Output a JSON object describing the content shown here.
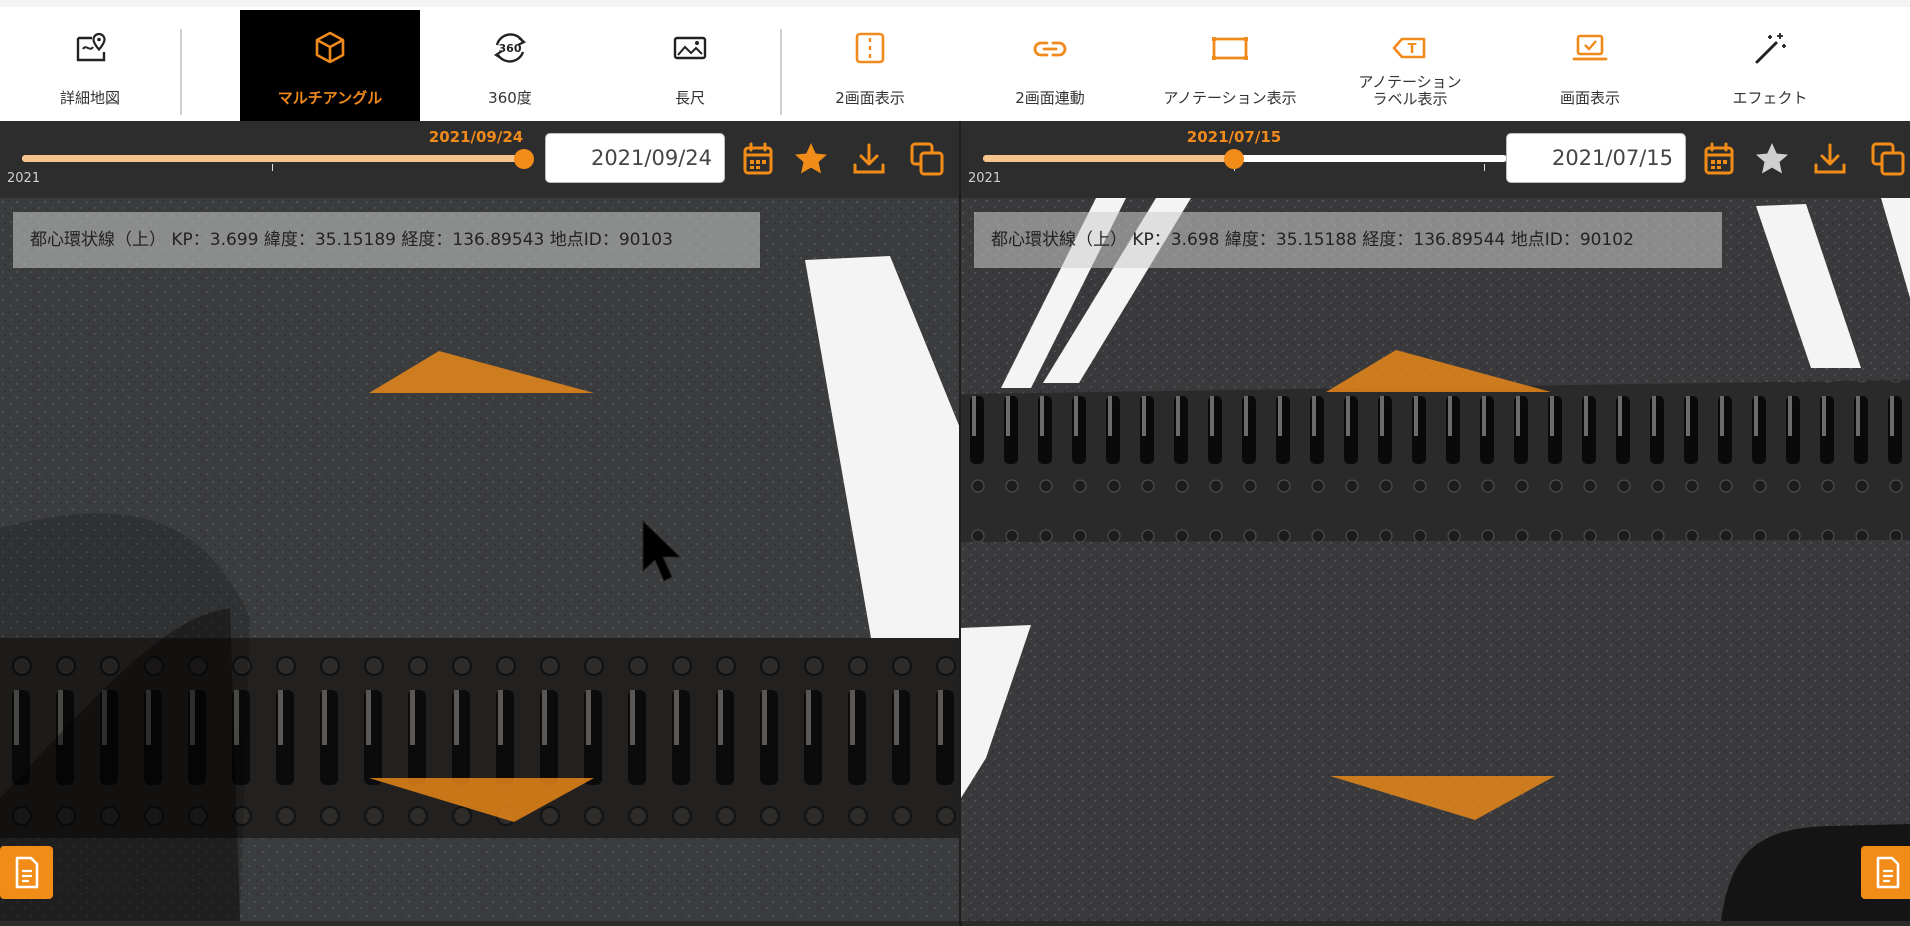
{
  "toolbar": {
    "items": [
      {
        "label": "詳細地図",
        "icon": "map-pin-icon"
      },
      {
        "label": "マルチアングル",
        "icon": "cube-icon",
        "active": true
      },
      {
        "label": "360度",
        "icon": "rotate-360-icon"
      },
      {
        "label": "長尺",
        "icon": "landscape-image-icon"
      },
      {
        "label": "2画面表示",
        "icon": "split-screen-icon"
      },
      {
        "label": "2画面連動",
        "icon": "link-icon"
      },
      {
        "label": "アノテーション表示",
        "icon": "rectangle-icon"
      },
      {
        "label": "アノテーション\nラベル表示",
        "label_line1": "アノテーション",
        "label_line2": "ラベル表示",
        "icon": "text-tag-icon"
      },
      {
        "label": "画面表示",
        "icon": "laptop-check-icon"
      },
      {
        "label": "エフェクト",
        "icon": "magic-wand-icon"
      }
    ]
  },
  "left_pane": {
    "slider_date": "2021/09/24",
    "slider_value_pct": 100,
    "year_label": "2021",
    "date_value": "2021/09/24",
    "favorite_active": true,
    "info": "都心環状線（上）  KP：3.699    緯度：35.15189    経度：136.89543    地点ID：90103"
  },
  "right_pane": {
    "slider_date": "2021/07/15",
    "slider_value_pct": 50,
    "year_label": "2021",
    "date_value": "2021/07/15",
    "favorite_active": false,
    "info": "都心環状線（上）  KP：3.698    緯度：35.15188    経度：136.89544    地点ID：90102"
  },
  "colors": {
    "accent": "#f28c18",
    "accent_light": "#f5c48c",
    "active_tab_bg": "#000000",
    "control_bar_bg": "#2d2d2d"
  }
}
